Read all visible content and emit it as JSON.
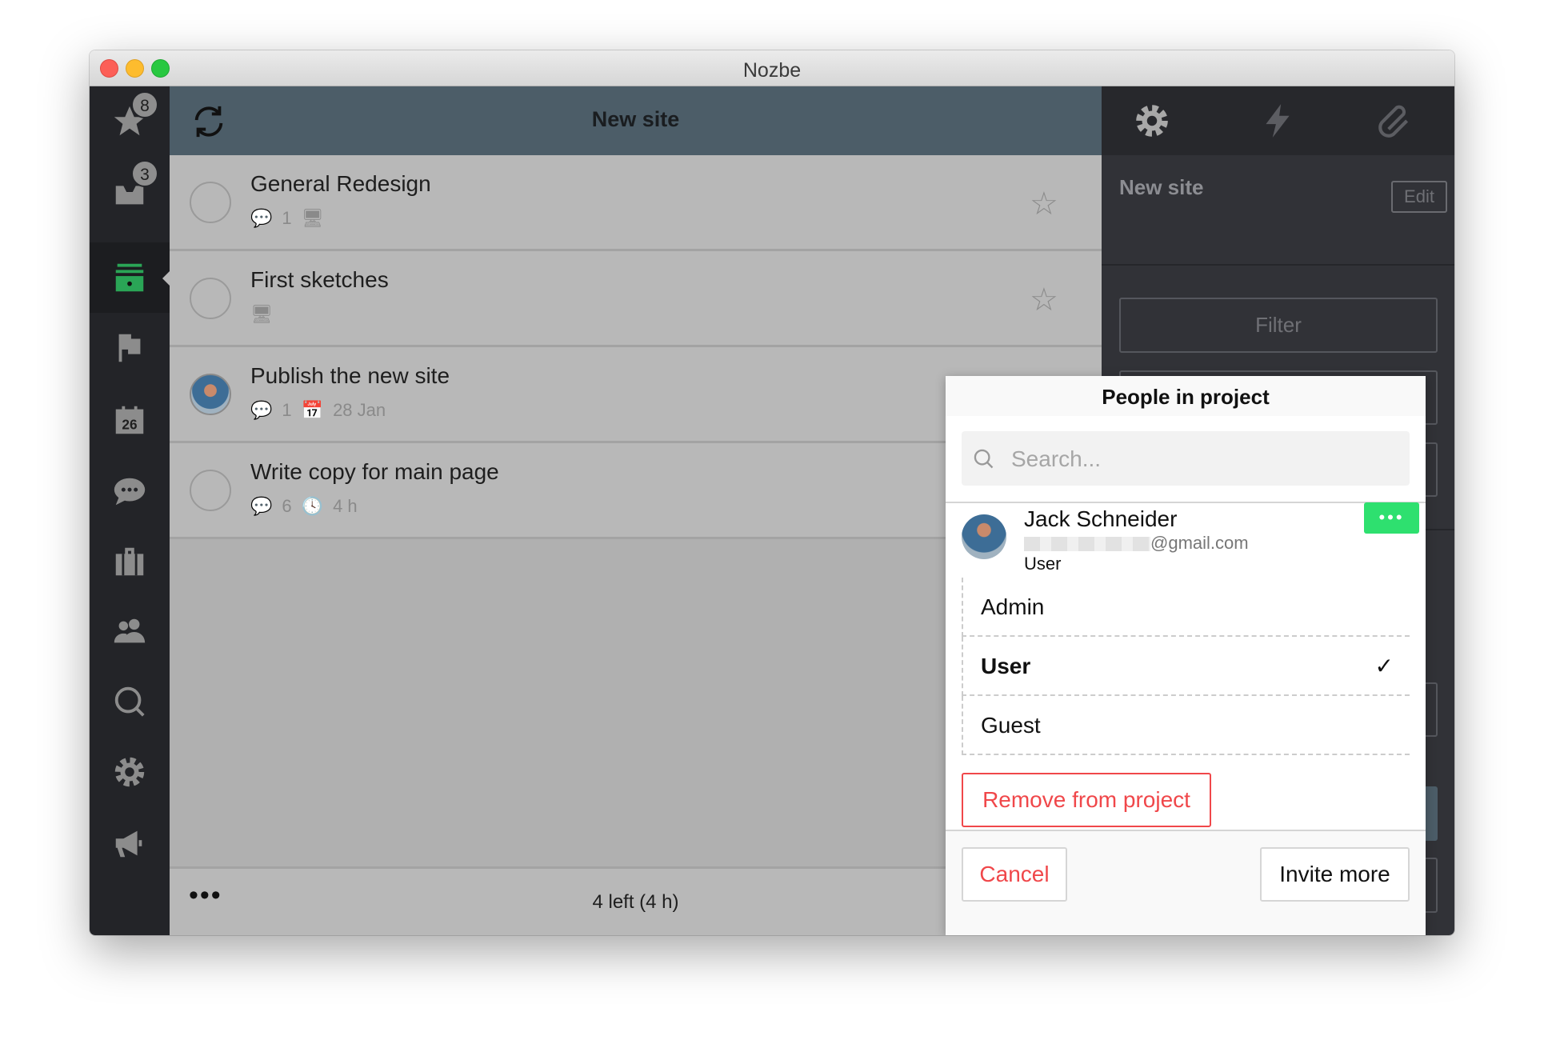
{
  "window": {
    "title": "Nozbe"
  },
  "sidebar": {
    "items": [
      {
        "name": "priority",
        "icon": "star-icon",
        "badge": "8"
      },
      {
        "name": "inbox",
        "icon": "inbox-icon",
        "badge": "3"
      },
      {
        "name": "projects",
        "icon": "projects-icon",
        "active": true
      },
      {
        "name": "categories",
        "icon": "flag-icon"
      },
      {
        "name": "calendar",
        "icon": "calendar-icon",
        "label": "26"
      },
      {
        "name": "comments",
        "icon": "chat-icon"
      },
      {
        "name": "templates",
        "icon": "briefcase-icon"
      },
      {
        "name": "team",
        "icon": "people-icon"
      },
      {
        "name": "search",
        "icon": "search-icon"
      },
      {
        "name": "settings",
        "icon": "gear-icon"
      },
      {
        "name": "news",
        "icon": "megaphone-icon"
      }
    ]
  },
  "header": {
    "title": "New site"
  },
  "tasks": [
    {
      "title": "General Redesign",
      "comments": "1",
      "has_attachment": true
    },
    {
      "title": "First sketches",
      "has_attachment": true
    },
    {
      "title": "Publish the new site",
      "comments": "1",
      "date": "28 Jan",
      "assignee_avatar": true
    },
    {
      "title": "Write copy for main page",
      "comments": "6",
      "time": "4 h"
    }
  ],
  "footer": {
    "summary": "4 left (4 h)"
  },
  "right_panel": {
    "project_name": "New site",
    "edit_label": "Edit",
    "filter_label": "Filter"
  },
  "popup": {
    "title": "People in project",
    "search_placeholder": "Search...",
    "person": {
      "name": "Jack Schneider",
      "email": "@gmail.com",
      "role": "User"
    },
    "roles": [
      {
        "label": "Admin"
      },
      {
        "label": "User",
        "selected": true
      },
      {
        "label": "Guest"
      }
    ],
    "remove_label": "Remove from project",
    "cancel_label": "Cancel",
    "invite_label": "Invite more"
  },
  "colors": {
    "accent_green": "#2ee06f",
    "danger": "#f0474a",
    "header": "#4c5d68"
  }
}
